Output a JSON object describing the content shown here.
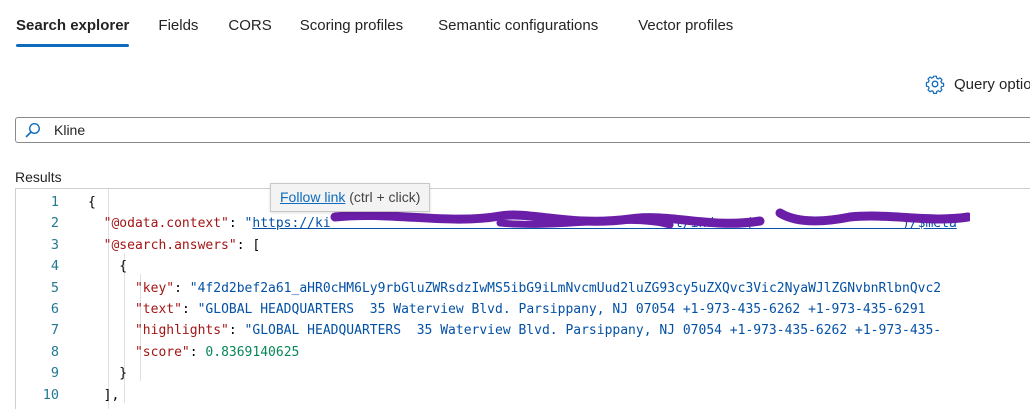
{
  "tabs": [
    {
      "label": "Search explorer",
      "active": true
    },
    {
      "label": "Fields"
    },
    {
      "label": "CORS"
    },
    {
      "label": "Scoring profiles"
    },
    {
      "label": "Semantic configurations"
    },
    {
      "label": "Vector profiles"
    }
  ],
  "query_options": {
    "label": "Query optio",
    "icon": "gear-icon"
  },
  "search": {
    "value": "Kline",
    "icon": "search-icon"
  },
  "results": {
    "label": "Results"
  },
  "tooltip": {
    "link": "Follow link",
    "hint": "(ctrl + click)"
  },
  "editor": {
    "lines": [
      {
        "num": "1",
        "parts": [
          {
            "t": "{",
            "c": "p"
          }
        ]
      },
      {
        "num": "2",
        "parts": [
          {
            "t": "  ",
            "c": "p"
          },
          {
            "t": "\"@odata.context\"",
            "c": "k"
          },
          {
            "t": ": ",
            "c": "p"
          },
          {
            "t": "\"",
            "c": "s"
          },
          {
            "t": "https://ki                                            t/indexes('                 ')/$meta",
            "c": "s u"
          }
        ]
      },
      {
        "num": "3",
        "parts": [
          {
            "t": "  ",
            "c": "p"
          },
          {
            "t": "\"@search.answers\"",
            "c": "k"
          },
          {
            "t": ": [",
            "c": "p"
          }
        ]
      },
      {
        "num": "4",
        "parts": [
          {
            "t": "    {",
            "c": "p"
          }
        ]
      },
      {
        "num": "5",
        "parts": [
          {
            "t": "      ",
            "c": "p"
          },
          {
            "t": "\"key\"",
            "c": "k"
          },
          {
            "t": ": ",
            "c": "p"
          },
          {
            "t": "\"4f2d2bef2a61_aHR0cHM6Ly9rbGluZWRsdzIwMS5ibG9iLmNvcmUud2luZG93cy5uZXQvc3Vic2NyaWJlZGNvbnRlbnQvc2",
            "c": "s"
          }
        ]
      },
      {
        "num": "6",
        "parts": [
          {
            "t": "      ",
            "c": "p"
          },
          {
            "t": "\"text\"",
            "c": "k"
          },
          {
            "t": ": ",
            "c": "p"
          },
          {
            "t": "\"GLOBAL HEADQUARTERS  35 Waterview Blvd. Parsippany, NJ 07054 +1-973-435-6262 +1-973-435-6291",
            "c": "s"
          }
        ]
      },
      {
        "num": "7",
        "parts": [
          {
            "t": "      ",
            "c": "p"
          },
          {
            "t": "\"highlights\"",
            "c": "k"
          },
          {
            "t": ": ",
            "c": "p"
          },
          {
            "t": "\"GLOBAL HEADQUARTERS  35 Waterview Blvd. Parsippany, NJ 07054 +1-973-435-6262 +1-973-435-",
            "c": "s"
          }
        ]
      },
      {
        "num": "8",
        "parts": [
          {
            "t": "      ",
            "c": "p"
          },
          {
            "t": "\"score\"",
            "c": "k"
          },
          {
            "t": ": ",
            "c": "p"
          },
          {
            "t": "0.8369140625",
            "c": "n"
          }
        ]
      },
      {
        "num": "9",
        "parts": [
          {
            "t": "    }",
            "c": "p"
          }
        ]
      },
      {
        "num": "10",
        "parts": [
          {
            "t": "  ],",
            "c": "p"
          }
        ]
      }
    ]
  },
  "colors": {
    "accent": "#0f6cbd",
    "json_key": "#a31515",
    "json_string": "#0451a5",
    "json_number": "#098658",
    "line_number": "#237893",
    "redaction": "#6b1fa8"
  }
}
